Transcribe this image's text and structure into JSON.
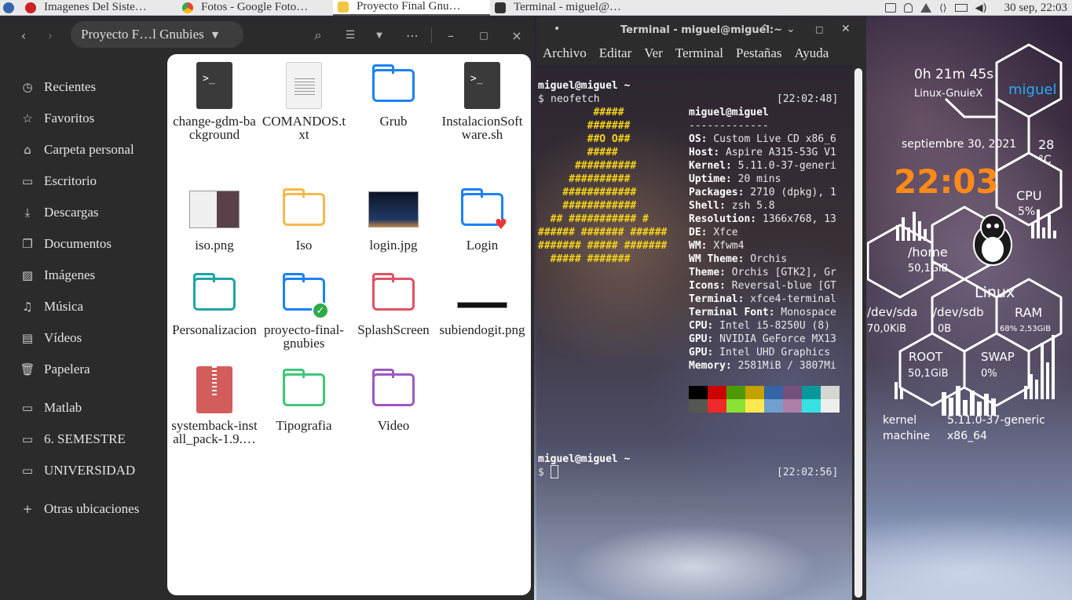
{
  "panel": {
    "tasks": [
      {
        "label": "Imagenes Del Siste…",
        "icon_color": "#cc2222"
      },
      {
        "label": "Fotos - Google Foto…",
        "icon_color": "#4285f4"
      },
      {
        "label": "Proyecto Final Gnu…",
        "icon_color": "#f4c542"
      },
      {
        "label": "Terminal - miguel@…",
        "icon_color": "#333333"
      }
    ],
    "clock": "30 sep, 22:03"
  },
  "file_manager": {
    "path": "Proyecto F…l Gnubies",
    "sidebar": [
      {
        "label": "Recientes",
        "icon": "clock-icon"
      },
      {
        "label": "Favoritos",
        "icon": "star-icon"
      },
      {
        "label": "Carpeta personal",
        "icon": "home-icon"
      },
      {
        "label": "Escritorio",
        "icon": "desktop-icon"
      },
      {
        "label": "Descargas",
        "icon": "download-icon"
      },
      {
        "label": "Documentos",
        "icon": "document-icon"
      },
      {
        "label": "Imágenes",
        "icon": "image-icon"
      },
      {
        "label": "Música",
        "icon": "music-icon"
      },
      {
        "label": "Vídeos",
        "icon": "video-icon"
      },
      {
        "label": "Papelera",
        "icon": "trash-icon"
      },
      {
        "label": "Matlab",
        "icon": "folder-icon"
      },
      {
        "label": "6. SEMESTRE",
        "icon": "folder-icon"
      },
      {
        "label": "UNIVERSIDAD",
        "icon": "folder-icon"
      },
      {
        "label": "Otras ubicaciones",
        "icon": "plus-icon"
      }
    ],
    "files": [
      {
        "label": "change-gdm-background",
        "kind": "script"
      },
      {
        "label": "COMANDOS.txt",
        "kind": "text"
      },
      {
        "label": "Grub",
        "kind": "folder-blue"
      },
      {
        "label": "InstalacionSoftware.sh",
        "kind": "script"
      },
      {
        "label": "iso.png",
        "kind": "thumb-iso"
      },
      {
        "label": "Iso",
        "kind": "folder-yellow"
      },
      {
        "label": "login.jpg",
        "kind": "thumb-login"
      },
      {
        "label": "Login",
        "kind": "folder-blue-heart"
      },
      {
        "label": "Personalizacion",
        "kind": "folder-teal"
      },
      {
        "label": "proyecto-final-gnubies",
        "kind": "folder-blue-check"
      },
      {
        "label": "SplashScreen",
        "kind": "folder-red"
      },
      {
        "label": "subiendogit.png",
        "kind": "thumb-bar"
      },
      {
        "label": "systemback-install_pack-1.9.…",
        "kind": "archive"
      },
      {
        "label": "Tipografia",
        "kind": "folder-green"
      },
      {
        "label": "Video",
        "kind": "folder-purple"
      }
    ]
  },
  "terminal": {
    "title": "Terminal - miguel@miguel:~",
    "menu": [
      "Archivo",
      "Editar",
      "Ver",
      "Terminal",
      "Pestañas",
      "Ayuda"
    ],
    "prompt_user": "miguel@miguel ~",
    "prompt_symbol": "$",
    "command": "neofetch",
    "time1": "[22:02:48]",
    "time2": "[22:02:56]",
    "header": "miguel@miguel",
    "separator": "-------------",
    "info": [
      {
        "key": "OS",
        "value": "Custom Live CD x86_6"
      },
      {
        "key": "Host",
        "value": "Aspire A315-53G V1"
      },
      {
        "key": "Kernel",
        "value": "5.11.0-37-generi"
      },
      {
        "key": "Uptime",
        "value": "20 mins"
      },
      {
        "key": "Packages",
        "value": "2710 (dpkg), 1"
      },
      {
        "key": "Shell",
        "value": "zsh 5.8"
      },
      {
        "key": "Resolution",
        "value": "1366x768, 13"
      },
      {
        "key": "DE",
        "value": "Xfce"
      },
      {
        "key": "WM",
        "value": "Xfwm4"
      },
      {
        "key": "WM Theme",
        "value": "Orchis"
      },
      {
        "key": "Theme",
        "value": "Orchis [GTK2], Gr"
      },
      {
        "key": "Icons",
        "value": "Reversal-blue [GT"
      },
      {
        "key": "Terminal",
        "value": "xfce4-terminal"
      },
      {
        "key": "Terminal Font",
        "value": "Monospace"
      },
      {
        "key": "CPU",
        "value": "Intel i5-8250U (8)"
      },
      {
        "key": "GPU",
        "value": "NVIDIA GeForce MX13"
      },
      {
        "key": "GPU",
        "value": "Intel UHD Graphics"
      },
      {
        "key": "Memory",
        "value": "2581MiB / 3807Mi"
      }
    ],
    "logo": [
      "         #####",
      "        #######",
      "        ##O O##",
      "        #####",
      "      ##########",
      "     ##########",
      "    ############",
      "    ############",
      "  ## ########### #",
      "###### ####### ######",
      "####### ##### #######",
      "  ##### #######"
    ],
    "palette_top": [
      "#000000",
      "#cc0000",
      "#4e9a06",
      "#c4a000",
      "#3465a4",
      "#75507b",
      "#06989a",
      "#d3d7cf"
    ],
    "palette_bottom": [
      "#555753",
      "#ef2929",
      "#8ae234",
      "#fce94f",
      "#729fcf",
      "#ad7fa8",
      "#34e2e2",
      "#eeeeec"
    ]
  },
  "conky": {
    "uptime": "0h 21m 45s",
    "user": "miguel",
    "distro": "Linux-GnuieX",
    "date": "septiembre 30, 2021",
    "temp": "28",
    "temp_unit": "°C",
    "time": "22:03",
    "cpu_label": "CPU",
    "cpu_value": "5%",
    "home_label": "/home",
    "home_value": "50,1GiB",
    "os_label": "Linux",
    "sda_label": "/dev/sda",
    "sda_value": "70,0KiB",
    "sdb_label": "/dev/sdb",
    "sdb_value": "0B",
    "ram_label": "RAM",
    "ram_value": "68% 2,53GiB",
    "root_label": "ROOT",
    "root_value": "50,1GiB",
    "swap_label": "SWAP",
    "swap_value": "0%",
    "kernel_label": "kernel",
    "kernel_value": "5.11.0-37-generic",
    "machine_label": "machine",
    "machine_value": "x86_64",
    "accent": "#29a9ff",
    "time_color": "#ff8a1a"
  }
}
